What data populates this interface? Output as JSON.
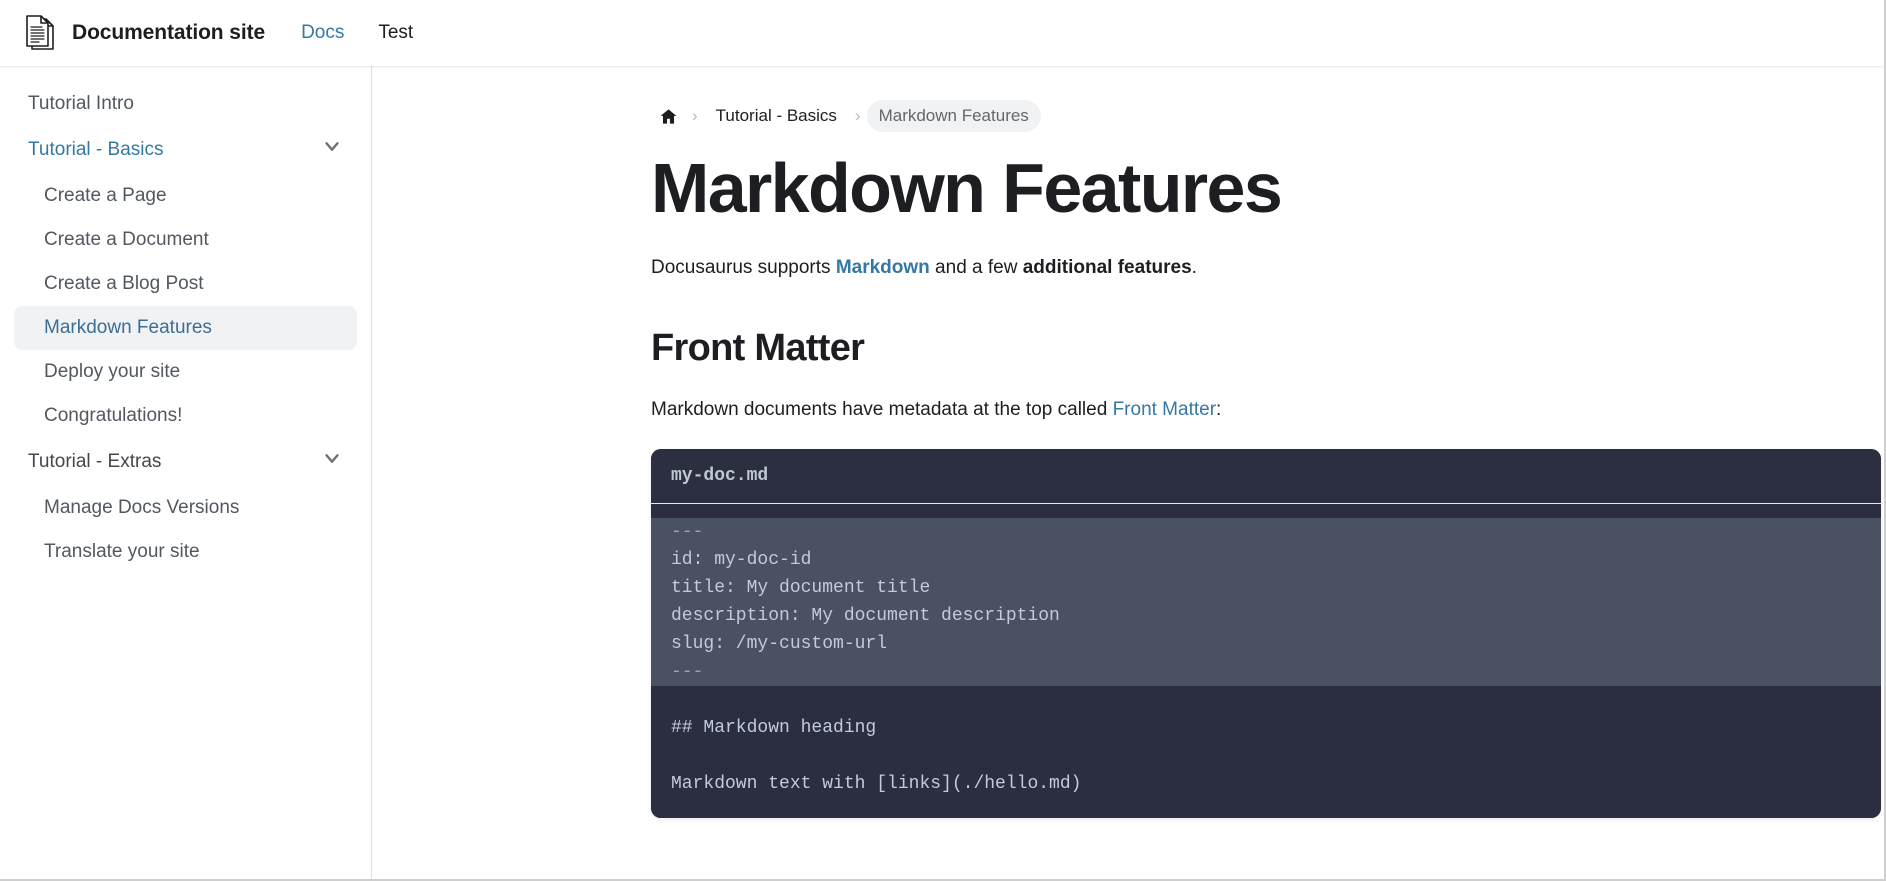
{
  "navbar": {
    "logo_icon": "documents-icon",
    "brand_title": "Documentation site",
    "links": [
      {
        "label": "Docs",
        "active": true
      },
      {
        "label": "Test",
        "active": false
      }
    ]
  },
  "sidebar": {
    "items": [
      {
        "label": "Tutorial Intro",
        "level": 1,
        "type": "link",
        "active": false
      },
      {
        "label": "Tutorial - Basics",
        "level": 1,
        "type": "category",
        "active": false,
        "expanded": true,
        "accent": true
      },
      {
        "label": "Create a Page",
        "level": 2,
        "type": "link",
        "active": false
      },
      {
        "label": "Create a Document",
        "level": 2,
        "type": "link",
        "active": false
      },
      {
        "label": "Create a Blog Post",
        "level": 2,
        "type": "link",
        "active": false
      },
      {
        "label": "Markdown Features",
        "level": 2,
        "type": "link",
        "active": true
      },
      {
        "label": "Deploy your site",
        "level": 2,
        "type": "link",
        "active": false
      },
      {
        "label": "Congratulations!",
        "level": 2,
        "type": "link",
        "active": false
      },
      {
        "label": "Tutorial - Extras",
        "level": 1,
        "type": "category",
        "active": false,
        "expanded": true,
        "accent": false
      },
      {
        "label": "Manage Docs Versions",
        "level": 2,
        "type": "link",
        "active": false
      },
      {
        "label": "Translate your site",
        "level": 2,
        "type": "link",
        "active": false
      }
    ],
    "chevron_icon": "chevron-down-icon"
  },
  "breadcrumbs": {
    "home_icon": "home-icon",
    "separator": "›",
    "items": [
      {
        "label": "Tutorial - Basics",
        "current": false
      },
      {
        "label": "Markdown Features",
        "current": true
      }
    ]
  },
  "doc": {
    "title": "Markdown Features",
    "intro": {
      "lead": "Docusaurus supports ",
      "link_text": "Markdown",
      "middle": " and a few ",
      "strong_text": "additional features",
      "tail": "."
    },
    "section_front_matter": {
      "heading": "Front Matter",
      "paragraph_lead": "Markdown documents have metadata at the top called ",
      "paragraph_link": "Front Matter",
      "paragraph_tail": ":"
    },
    "code_block": {
      "filename": "my-doc.md",
      "language": "markdown",
      "lines": [
        {
          "text": "---",
          "highlight": true,
          "dim": true
        },
        {
          "text": "id: my-doc-id",
          "highlight": true,
          "dim": false
        },
        {
          "text": "title: My document title",
          "highlight": true,
          "dim": false
        },
        {
          "text": "description: My document description",
          "highlight": true,
          "dim": false
        },
        {
          "text": "slug: /my-custom-url",
          "highlight": true,
          "dim": false
        },
        {
          "text": "---",
          "highlight": true,
          "dim": true
        },
        {
          "text": "",
          "highlight": false,
          "dim": false
        },
        {
          "text": "## Markdown heading",
          "highlight": false,
          "dim": false
        },
        {
          "text": "",
          "highlight": false,
          "dim": false
        },
        {
          "text": "Markdown text with [links](./hello.md)",
          "highlight": false,
          "dim": false
        }
      ]
    }
  },
  "colors": {
    "accent": "#3578a5",
    "text": "#1c1e21",
    "sidebar_text": "#525860",
    "active_bg": "#f1f2f3",
    "code_bg": "#2a2e3e",
    "code_header_bg": "#2b2f40",
    "code_highlight_bg": "#4a5160"
  }
}
